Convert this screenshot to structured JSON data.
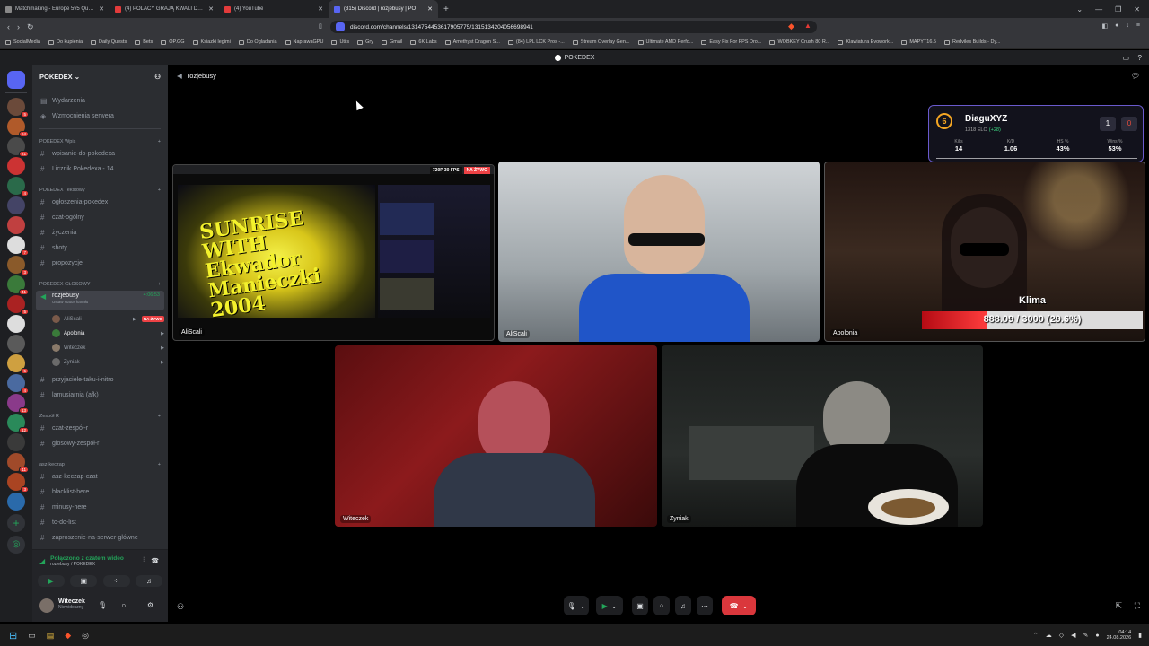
{
  "browser": {
    "tabs": [
      {
        "label": "Matchmaking - Europe 5v5 Queue"
      },
      {
        "label": "(4) POLACY GRAJĄ KWALI DO IEM C"
      },
      {
        "label": "(4) YouTube"
      },
      {
        "label": "(315) Discord | rozjebusy | PO"
      }
    ],
    "url": "discord.com/channels/1314754453617905775/1315134204056698941",
    "bookmarks": [
      "SocialMedia",
      "Do kupienia",
      "Daily Quests",
      "Bets",
      "OP.GG",
      "Ksiazki legimi",
      "Do Ogladania",
      "NaprawaGPU",
      "Utils",
      "Gry",
      "Gmail",
      "6K Labs",
      "Amethyst Dragon S...",
      "(84) LPL LCK Pros -...",
      "Stream Overlay Gen...",
      "Ultimate AMD Perfo...",
      "Easy Fix For FPS Dro...",
      "WOBKEY Crush 80 R...",
      "Klawiatura Evowork...",
      "MAPYT16.5",
      "Redviles Builds - Dy..."
    ]
  },
  "discord": {
    "top_title": "POKEDEX",
    "server_name": "POKEDEX",
    "header_channel": "rozjebusy",
    "top_items": [
      "Wydarzenia",
      "Wzmocnienia serwera"
    ],
    "categories": {
      "wpis": "POKEDEX Wpis",
      "tekstowy": "POKEDEX Tekstowy",
      "glosowy": "POKEDEX GŁOSOWY",
      "zespol": "Zespół R",
      "asz": "asz-keczap"
    },
    "channels_wpis": [
      "wpisanie-do-pokedexa",
      "Licznik Pokedexa - 14"
    ],
    "channels_tekst": [
      "ogłoszenia-pokedex",
      "czat-ogólny",
      "życzenia",
      "shoty",
      "propozycje"
    ],
    "voice_channel": "rozjebusy",
    "voice_timer": "4:06:53",
    "voice_status": "Ustaw status kanału",
    "members": [
      {
        "name": "AliScali",
        "live": "NA ŻYWO"
      },
      {
        "name": "Apolonia"
      },
      {
        "name": "Witeczek"
      },
      {
        "name": "Zyniak"
      }
    ],
    "channels_after": [
      "przyjaciele-taku-i-nitro",
      "lamusiarnia (afk)"
    ],
    "channels_zespol": [
      "czat-zespół-r",
      "glosowy-zespół-r"
    ],
    "channels_asz": [
      "asz-keczap-czat",
      "blacklist-here",
      "minusy-here",
      "to-do-list",
      "zaproszenie-na-serwer-główne"
    ],
    "voice_connected": "Połączono z czatem wideo",
    "voice_connected_sub": "rozjebusy / POKEDEX",
    "user_name": "Witeczek",
    "user_status": "Niewidoczny",
    "guild_badges": [
      "5",
      "64",
      "21",
      "",
      "4",
      "",
      "",
      "7",
      "3",
      "41",
      "5",
      "",
      "",
      "5",
      "4",
      "13",
      "12",
      "",
      "11",
      "3",
      "",
      "",
      "",
      "",
      ""
    ]
  },
  "tiles": [
    {
      "name": "AliScali",
      "badge_fps": "720P 30 FPS",
      "badge_live": "NA ŻYWO",
      "screen_text": "SUNRISE WITH Ekwador Manieczki 2004"
    },
    {
      "name": "AliScali"
    },
    {
      "name": "Apolonia"
    },
    {
      "name": "Witeczek"
    },
    {
      "name": "Zyniak"
    }
  ],
  "overlay": {
    "level": "6",
    "player": "DiaguXYZ",
    "elo": "1318 ELO",
    "elo_delta": "(+28)",
    "score_left": "1",
    "score_right": "0",
    "stats": [
      {
        "label": "Kills",
        "value": "14"
      },
      {
        "label": "K/D",
        "value": "1.06"
      },
      {
        "label": "HS %",
        "value": "43%"
      },
      {
        "label": "Wins %",
        "value": "53%"
      }
    ]
  },
  "health": {
    "label": "Klima",
    "text": "888.09 / 3000 (29.6%)",
    "fraction": 0.296
  },
  "taskbar": {
    "time": "04:14",
    "date": "24.08.2026"
  }
}
